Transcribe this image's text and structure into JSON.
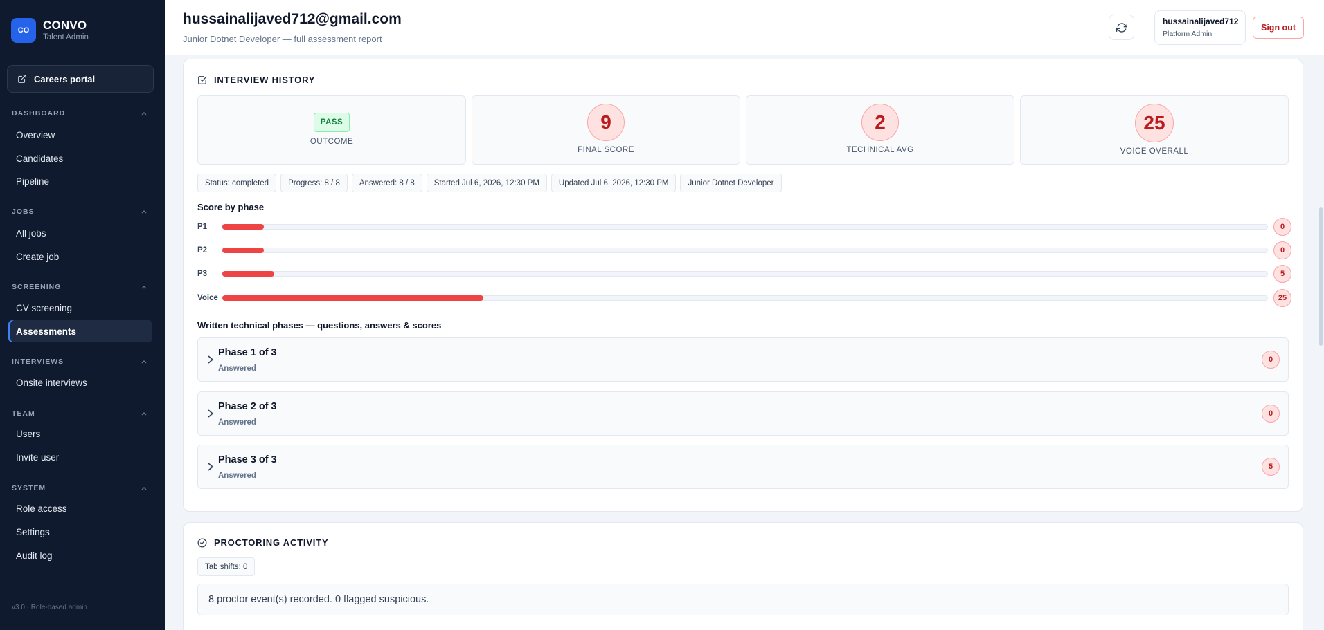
{
  "brand": {
    "logo": "CO",
    "name": "CONVO",
    "sub": "Talent Admin"
  },
  "sidebar": {
    "careers_label": "Careers portal",
    "sections": {
      "dashboard": "DASHBOARD",
      "jobs": "JOBS",
      "screening": "SCREENING",
      "interviews": "INTERVIEWS",
      "team": "TEAM",
      "system": "SYSTEM"
    },
    "items": {
      "overview": "Overview",
      "candidates": "Candidates",
      "pipeline": "Pipeline",
      "all_jobs": "All jobs",
      "create_job": "Create job",
      "cv_screening": "CV screening",
      "assessments": "Assessments",
      "onsite_interviews": "Onsite interviews",
      "users": "Users",
      "invite_user": "Invite user",
      "role_access": "Role access",
      "settings": "Settings",
      "audit_log": "Audit log"
    },
    "version": "v3.0 · Role-based admin"
  },
  "header": {
    "title": "hussainalijaved712@gmail.com",
    "subtitle": "Junior Dotnet Developer — full assessment report",
    "user_name": "hussainalijaved712",
    "user_role": "Platform Admin",
    "signout": "Sign out"
  },
  "interview": {
    "title": "INTERVIEW HISTORY",
    "outcome_badge": "PASS",
    "outcome_label": "OUTCOME",
    "final_score": "9",
    "final_label": "FINAL SCORE",
    "technical_avg": "2",
    "technical_label": "TECHNICAL AVG",
    "voice_overall": "25",
    "voice_label": "VOICE OVERALL",
    "chips": [
      "Status: completed",
      "Progress: 8 / 8",
      "Answered: 8 / 8",
      "Started Jul 6, 2026, 12:30 PM",
      "Updated Jul 6, 2026, 12:30 PM",
      "Junior Dotnet Developer"
    ],
    "score_by_phase_title": "Score by phase",
    "phase_bars": [
      {
        "label": "P1",
        "score": "0",
        "fill_fraction": 0.04
      },
      {
        "label": "P2",
        "score": "0",
        "fill_fraction": 0.04
      },
      {
        "label": "P3",
        "score": "5",
        "fill_fraction": 0.05
      },
      {
        "label": "Voice",
        "score": "25",
        "fill_fraction": 0.25
      }
    ],
    "written_title": "Written technical phases — questions, answers & scores",
    "phases": [
      {
        "title": "Phase 1 of 3",
        "status": "Answered",
        "score": "0"
      },
      {
        "title": "Phase 2 of 3",
        "status": "Answered",
        "score": "0"
      },
      {
        "title": "Phase 3 of 3",
        "status": "Answered",
        "score": "5"
      }
    ]
  },
  "proctoring": {
    "title": "PROCTORING ACTIVITY",
    "tab_shifts": "Tab shifts: 0",
    "message": "8 proctor event(s) recorded. 0 flagged suspicious."
  },
  "colors": {
    "sidebar_bg": "#0f1a2e",
    "accent": "#2563eb",
    "danger": "#ef4444",
    "pass": "#15803d"
  }
}
